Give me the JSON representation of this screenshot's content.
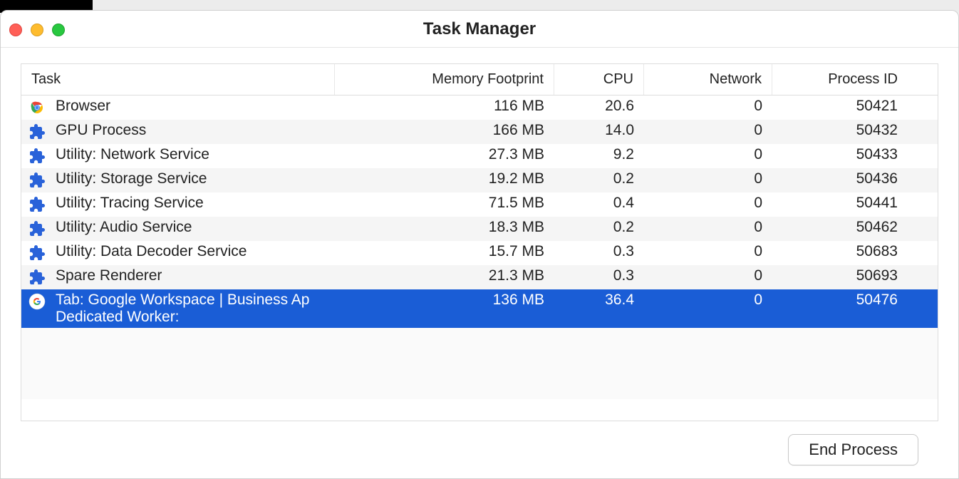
{
  "window": {
    "title": "Task Manager"
  },
  "columns": {
    "task": "Task",
    "memory": "Memory Footprint",
    "cpu": "CPU",
    "network": "Network",
    "pid": "Process ID"
  },
  "rows": [
    {
      "icon": "chrome",
      "name": "Browser",
      "sub": null,
      "memory": "116 MB",
      "cpu": "20.6",
      "network": "0",
      "pid": "50421",
      "selected": false
    },
    {
      "icon": "puzzle",
      "name": "GPU Process",
      "sub": null,
      "memory": "166 MB",
      "cpu": "14.0",
      "network": "0",
      "pid": "50432",
      "selected": false
    },
    {
      "icon": "puzzle",
      "name": "Utility: Network Service",
      "sub": null,
      "memory": "27.3 MB",
      "cpu": "9.2",
      "network": "0",
      "pid": "50433",
      "selected": false
    },
    {
      "icon": "puzzle",
      "name": "Utility: Storage Service",
      "sub": null,
      "memory": "19.2 MB",
      "cpu": "0.2",
      "network": "0",
      "pid": "50436",
      "selected": false
    },
    {
      "icon": "puzzle",
      "name": "Utility: Tracing Service",
      "sub": null,
      "memory": "71.5 MB",
      "cpu": "0.4",
      "network": "0",
      "pid": "50441",
      "selected": false
    },
    {
      "icon": "puzzle",
      "name": "Utility: Audio Service",
      "sub": null,
      "memory": "18.3 MB",
      "cpu": "0.2",
      "network": "0",
      "pid": "50462",
      "selected": false
    },
    {
      "icon": "puzzle",
      "name": "Utility: Data Decoder Service",
      "sub": null,
      "memory": "15.7 MB",
      "cpu": "0.3",
      "network": "0",
      "pid": "50683",
      "selected": false
    },
    {
      "icon": "puzzle",
      "name": "Spare Renderer",
      "sub": null,
      "memory": "21.3 MB",
      "cpu": "0.3",
      "network": "0",
      "pid": "50693",
      "selected": false
    },
    {
      "icon": "google",
      "name": "Tab: Google Workspace | Business Ap",
      "sub": "Dedicated Worker:",
      "memory": "136 MB",
      "cpu": "36.4",
      "network": "0",
      "pid": "50476",
      "selected": true
    }
  ],
  "footer": {
    "end_process": "End Process"
  }
}
